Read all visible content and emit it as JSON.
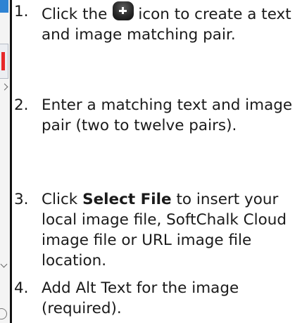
{
  "instructions": {
    "steps": [
      {
        "number": "1.",
        "before_icon": "Click the",
        "icon": "plus-icon",
        "after_icon": "icon to create a text and image matching pair."
      },
      {
        "number": "2.",
        "text": "Enter a matching text and image pair (two to twelve pairs)."
      },
      {
        "number": "3.",
        "before_bold": "Click",
        "bold": "Select File",
        "after_bold": "to insert your local image file, SoftChalk Cloud image file or URL image file location."
      },
      {
        "number": "4.",
        "text": "Add Alt Text for the image (required)."
      }
    ]
  },
  "colors": {
    "divider": "#111111",
    "strip_accent_blue": "#2e83d3",
    "strip_accent_red": "#e7282a",
    "text": "#1a1a1a"
  }
}
